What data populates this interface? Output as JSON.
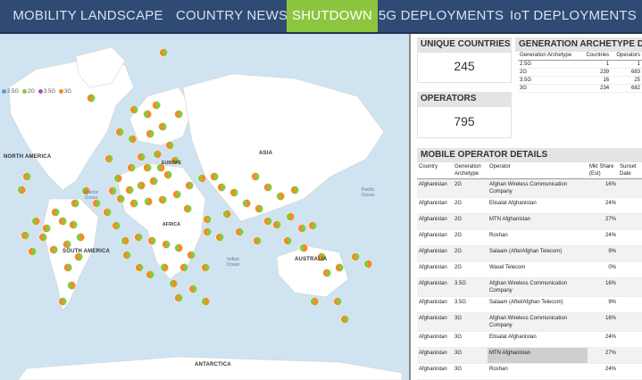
{
  "nav": {
    "tabs": [
      {
        "label": "MOBILITY LANDSCAPE"
      },
      {
        "label": "COUNTRY NEWS"
      },
      {
        "label": "SHUTDOWN"
      },
      {
        "label": "5G DEPLOYMENTS"
      },
      {
        "label": "IoT DEPLOYMENTS"
      }
    ],
    "active_index": 2
  },
  "map": {
    "legend": [
      {
        "label": "2.5G",
        "color": "#4da3d6"
      },
      {
        "label": "2G",
        "color": "#8cc63f"
      },
      {
        "label": "3.5G",
        "color": "#9b59b6"
      },
      {
        "label": "3G",
        "color": "#f28c28"
      }
    ],
    "labels": {
      "north_america": "NORTH AMERICA",
      "south_america": "SOUTH AMERICA",
      "asia": "ASIA",
      "australia": "AUSTRALIA",
      "antarctica": "ANTARCTICA",
      "europe": "EUROPE",
      "africa": "AFRICA"
    },
    "oceans": {
      "atlantic": "Atlantic Ocean",
      "pacific": "Pacific Ocean",
      "indian": "Indian Ocean"
    },
    "colors": {
      "water": "#cfe3f0",
      "land": "#ffffff",
      "marker_orange": "#f28c28",
      "marker_green": "#8cc63f"
    }
  },
  "unique_countries": {
    "title": "UNIQUE COUNTRIES",
    "value": "245"
  },
  "operators": {
    "title": "OPERATORS",
    "value": "795"
  },
  "generation_archetype": {
    "title": "GENERATION ARCHETYPE DETAILS",
    "headers": [
      "Generation Archetype",
      "Countries",
      "Operators"
    ],
    "rows": [
      [
        "2.5G",
        "1",
        "1"
      ],
      [
        "2G",
        "239",
        "683"
      ],
      [
        "3.5G",
        "16",
        "25"
      ],
      [
        "3G",
        "234",
        "682"
      ]
    ]
  },
  "mobile_operator_details": {
    "title": "MOBILE OPERATOR DETAILS",
    "headers": [
      "Country",
      "Generation Archetype",
      "Operator",
      "Mkt Share (Est)",
      "Sunset Date"
    ],
    "rows": [
      [
        "Afghanistan",
        "2G",
        "Afghan Wireless Communication Company",
        "16%",
        ""
      ],
      [
        "Afghanistan",
        "2G",
        "Etisalat Afghanistan",
        "24%",
        ""
      ],
      [
        "Afghanistan",
        "2G",
        "MTN Afghanistan",
        "27%",
        ""
      ],
      [
        "Afghanistan",
        "2G",
        "Roshan",
        "24%",
        ""
      ],
      [
        "Afghanistan",
        "2G",
        "Salaam (Afte/Afghan Telecom)",
        "9%",
        ""
      ],
      [
        "Afghanistan",
        "2G",
        "Wasel Telecom",
        "0%",
        ""
      ],
      [
        "Afghanistan",
        "3.5G",
        "Afghan Wireless Communication Company",
        "16%",
        ""
      ],
      [
        "Afghanistan",
        "3.5G",
        "Salaam (Aftel/Afghan Telecom)",
        "9%",
        ""
      ],
      [
        "Afghanistan",
        "3G",
        "Afghan Wireless Communication Company",
        "16%",
        ""
      ],
      [
        "Afghanistan",
        "3G",
        "Etisalat Afghanistan",
        "24%",
        ""
      ],
      [
        "Afghanistan",
        "3G",
        "MTN Afghanistan",
        "27%",
        ""
      ],
      [
        "Afghanistan",
        "3G",
        "Roshan",
        "24%",
        ""
      ]
    ],
    "highlight_row": 10
  }
}
